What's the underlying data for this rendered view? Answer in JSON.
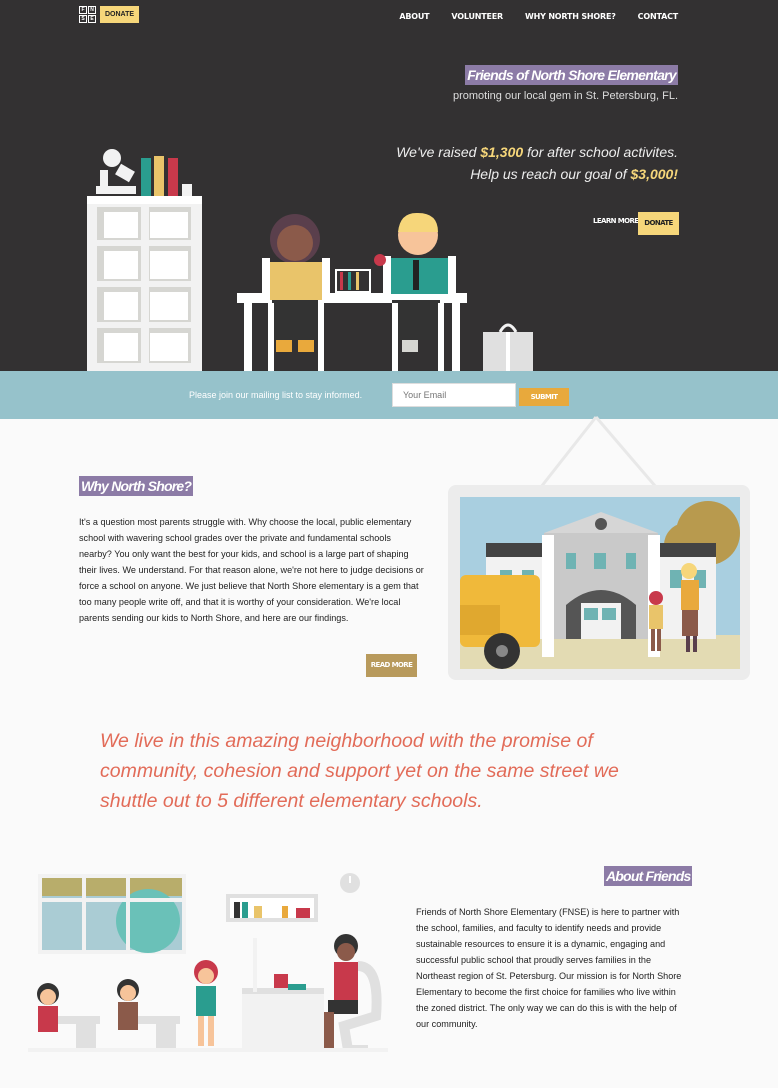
{
  "logo": {
    "letters": [
      "F",
      "N",
      "S",
      "E"
    ],
    "donate_label": "DONATE"
  },
  "nav": {
    "items": [
      "ABOUT",
      "VOLUNTEER",
      "WHY NORTH SHORE?",
      "CONTACT"
    ]
  },
  "hero": {
    "title": "Friends of North Shore Elementary",
    "subtitle": "promoting our local gem in St. Petersburg, FL.",
    "raised_prefix": "We've raised ",
    "raised_amount": "$1,300",
    "raised_suffix": " for after school activites.",
    "goal_prefix": "Help us reach our goal of ",
    "goal_amount": "$3,000!",
    "learn_more_label": "LEARN MORE",
    "donate_label": "DONATE"
  },
  "mailing": {
    "text": "Please join our mailing list to stay informed.",
    "placeholder": "Your Email",
    "submit_label": "SUBMIT"
  },
  "why": {
    "title": "Why North Shore?",
    "body": "It's a question most parents struggle with. Why choose the local, public elementary school with wavering school grades over the private and fundamental schools nearby? You only want the best for your kids, and school is a large part of shaping their lives. We understand. For that reason alone, we're not here to judge decisions or force a school on anyone. We just believe that North Shore elementary is a gem that too many people write off, and that it is worthy of your consideration. We're local parents sending our kids to North Shore, and here are our findings.",
    "read_more_label": "READ MORE"
  },
  "quote": "We live in this amazing neighborhood with the promise of community, cohesion and support yet on the same street we shuttle out to 5 different elementary schools.",
  "about": {
    "title": "About Friends",
    "body": "Friends of North Shore Elementary (FNSE) is here to partner with the school, families, and faculty to identify needs and provide sustainable resources to ensure it is a dynamic, engaging and successful public school that proudly serves families in the Northeast region of St. Petersburg. Our mission is for North Shore Elementary to become the first choice for families who live within the zoned district. The only way we can do this is with the help of our community."
  },
  "colors": {
    "dark": "#333132",
    "purple": "#8c7ba6",
    "yellow": "#f6d67a",
    "teal": "#96c2cb",
    "coral": "#e26b58",
    "orange": "#e8a93c",
    "gold": "#b89a5c"
  }
}
